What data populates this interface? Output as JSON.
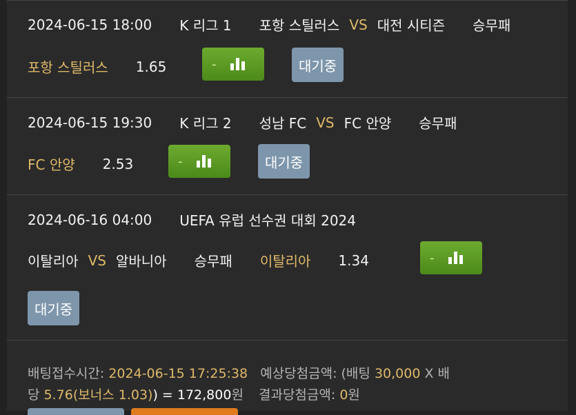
{
  "matches": [
    {
      "datetime": "2024-06-15 18:00",
      "league": "K 리그 1",
      "home": "포항 스틸러스",
      "vs": "VS",
      "away": "대전 시티즌",
      "bet_type": "승무패",
      "pick": "포항 스틸러스",
      "odds": "1.65",
      "stats_dash": "-",
      "status": "대기중"
    },
    {
      "datetime": "2024-06-15 19:30",
      "league": "K 리그 2",
      "home": "성남 FC",
      "vs": "VS",
      "away": "FC 안양",
      "bet_type": "승무패",
      "pick": "FC 안양",
      "odds": "2.53",
      "stats_dash": "-",
      "status": "대기중"
    },
    {
      "datetime": "2024-06-16 04:00",
      "league": "UEFA 유럽 선수권 대회 2024",
      "home": "이탈리아",
      "vs": "VS",
      "away": "알바니아",
      "bet_type": "승무패",
      "pick": "이탈리아",
      "odds": "1.34",
      "stats_dash": "-",
      "status": "대기중"
    }
  ],
  "bet_summary": {
    "time_label": "배팅접수시간:",
    "time_value": "2024-06-15  17:25:38",
    "expected_label": "예상당첨금액: (배팅",
    "stake": "30,000",
    "times": "X 배",
    "odds_prefix": "당",
    "total_odds": "5.76(보너스  1.03)",
    "equals": ") = ",
    "expected_amount": "172,800",
    "won": "원",
    "result_label": "결과당첨금액:",
    "result_amount": "0",
    "result_won": "원"
  },
  "colors": {
    "accent_gold": "#e0b96a",
    "green_button": "#5a9a22",
    "wait_button": "#7e96ab"
  }
}
